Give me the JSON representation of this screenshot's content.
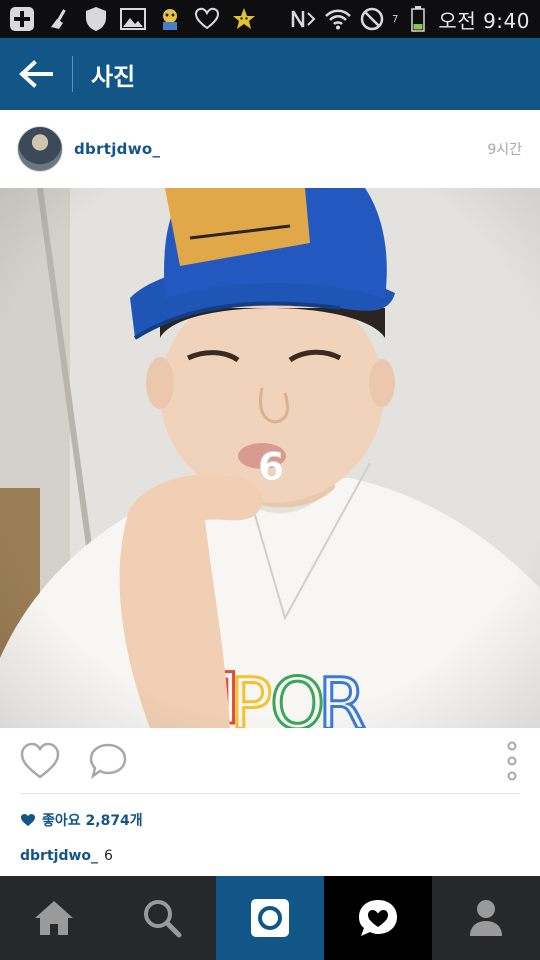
{
  "status_bar": {
    "time": "오전 9:40",
    "network": "7"
  },
  "header": {
    "title": "사진"
  },
  "post": {
    "username": "dbrtjdwo_",
    "time_ago": "9시간",
    "likes_text": "좋아요 2,874개",
    "caption_user": "dbrtjdwo_",
    "caption_text": "6"
  },
  "colors": {
    "brand_blue": "#125688",
    "nav_bg": "#26282a",
    "status_bg": "#0e0e10"
  },
  "icons": {
    "back": "back-arrow-icon",
    "like": "heart-outline-icon",
    "comment": "speech-bubble-icon",
    "more": "vertical-dots-icon",
    "nav": [
      "home-icon",
      "search-icon",
      "camera-icon",
      "activity-heart-icon",
      "profile-icon"
    ]
  }
}
